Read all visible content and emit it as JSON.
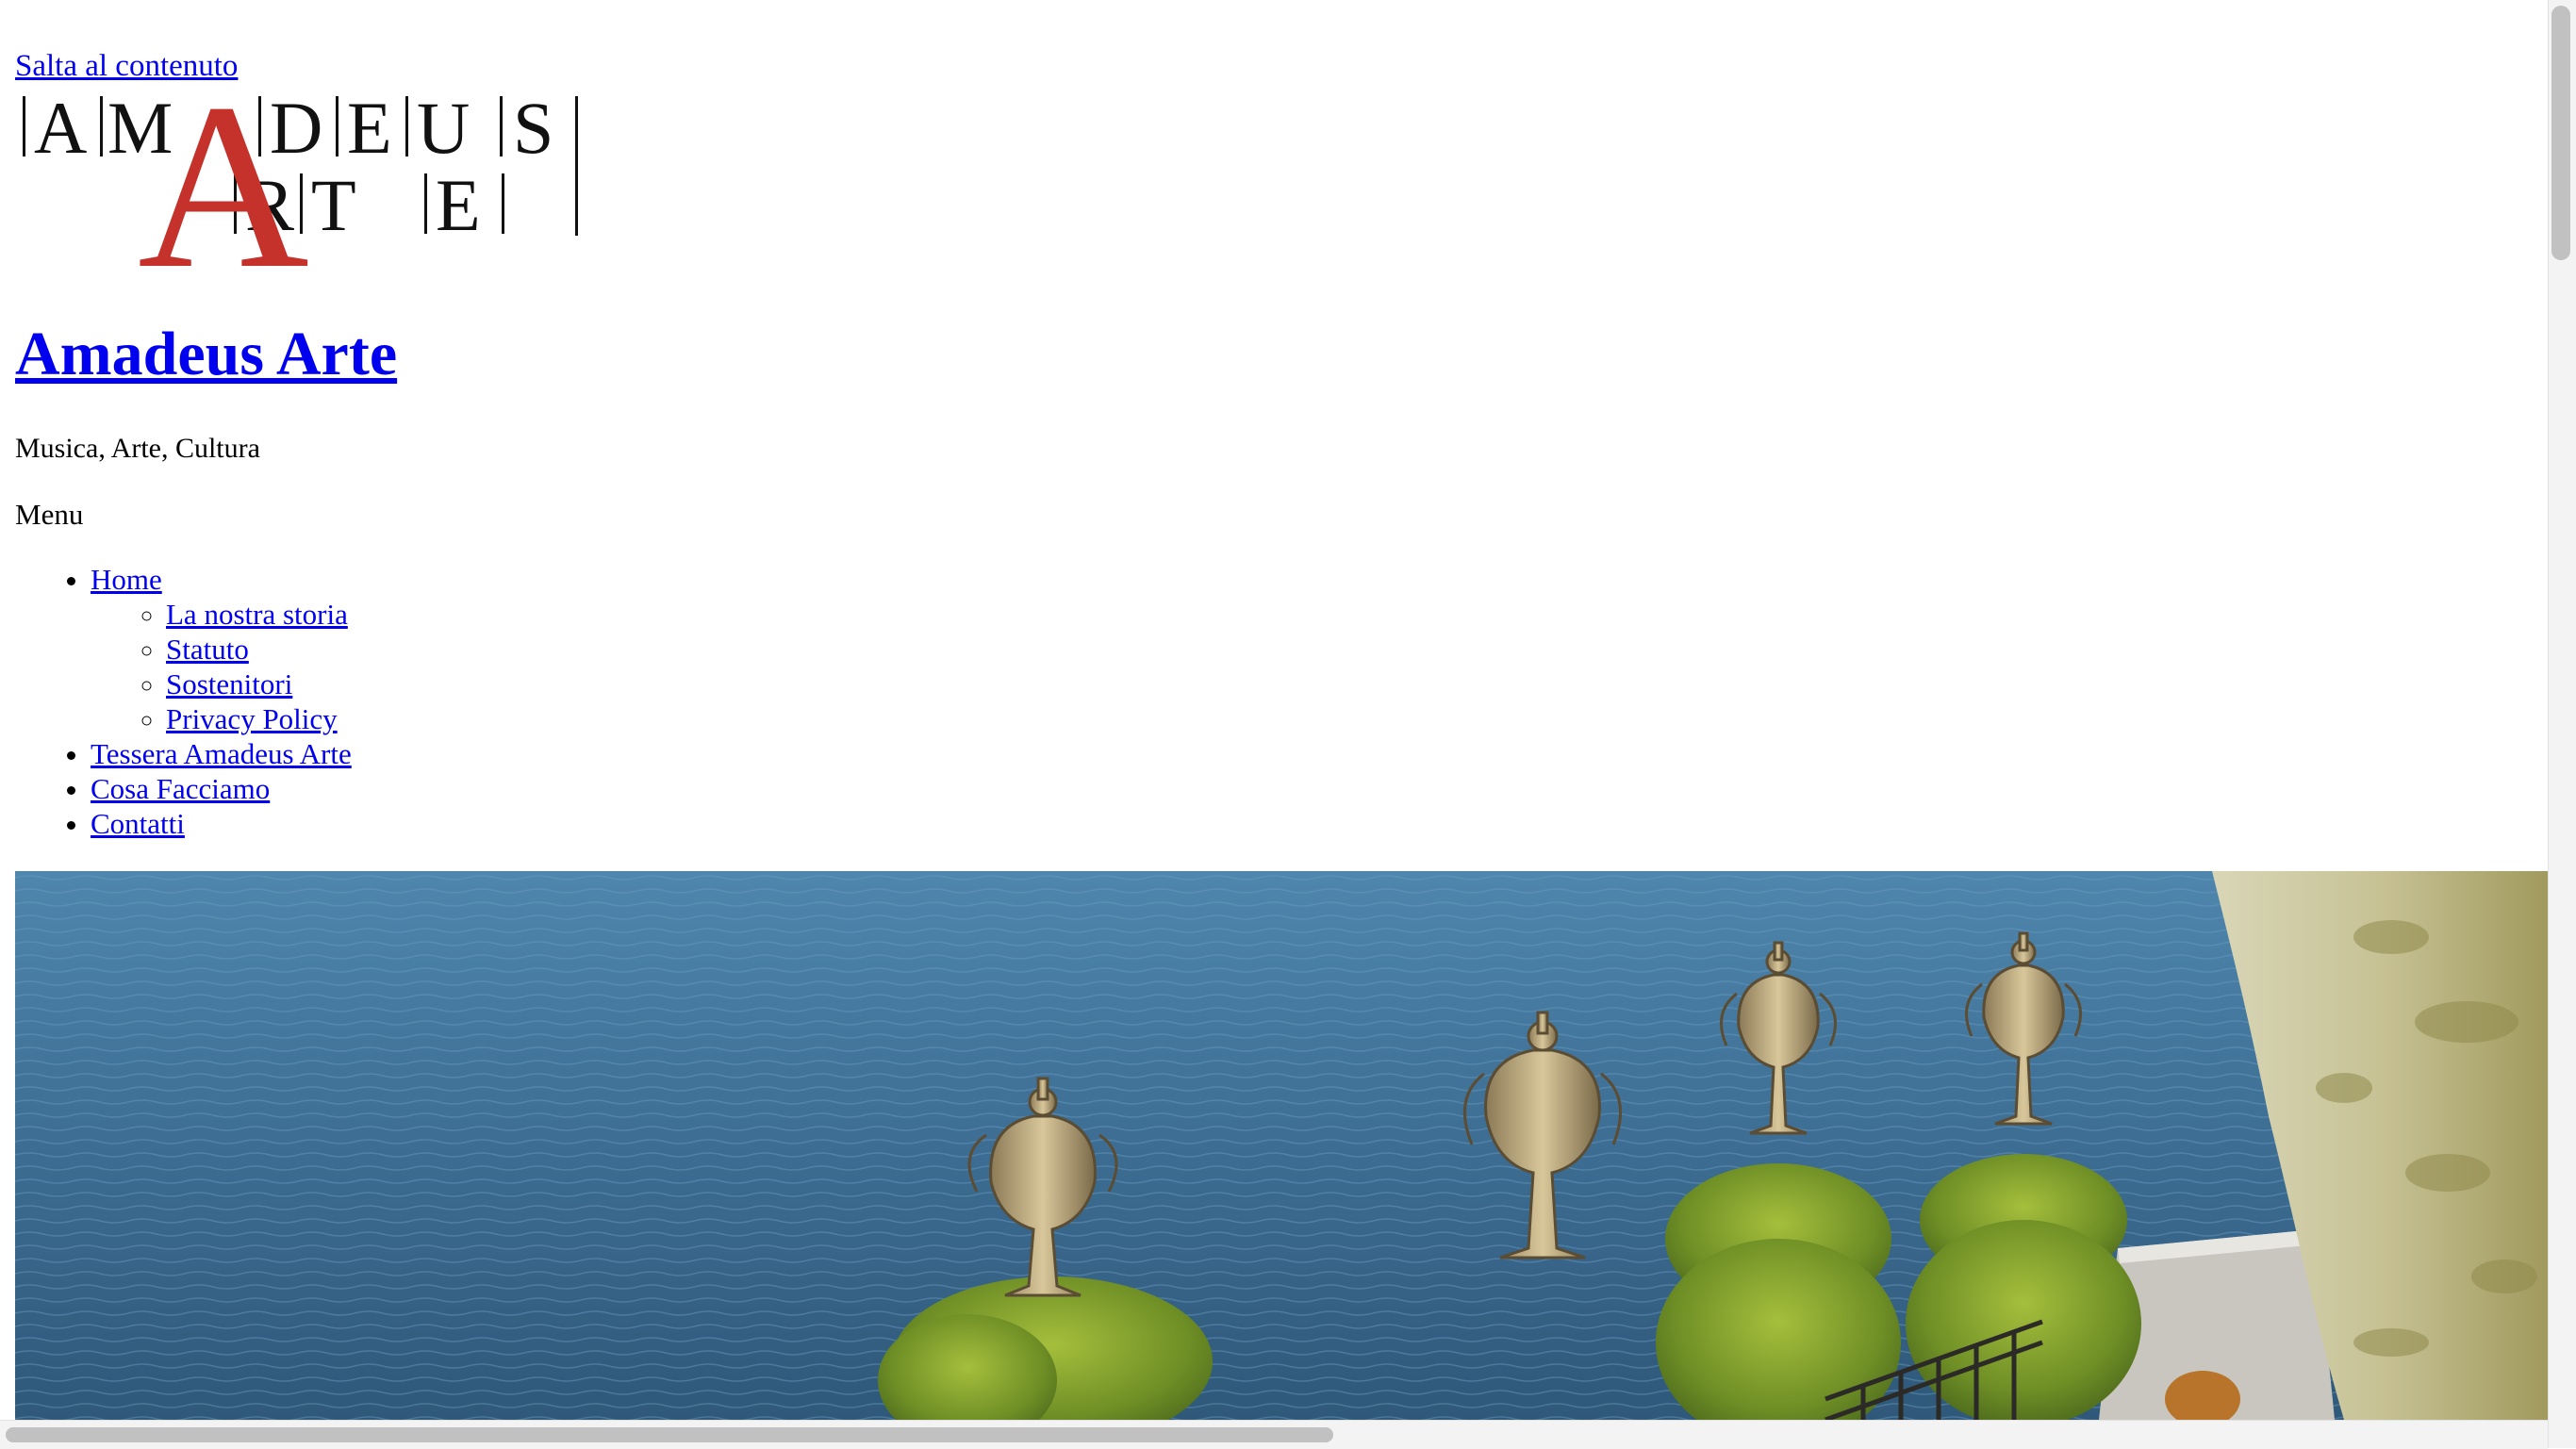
{
  "skip_link": "Salta al contenuto",
  "logo": {
    "top_letters": [
      "A",
      "M",
      "D",
      "E",
      "U",
      "S"
    ],
    "bottom_letters": [
      "R",
      "T",
      "E"
    ],
    "big_letter": "A",
    "accent": "#c4322b"
  },
  "site": {
    "title": "Amadeus Arte",
    "description": "Musica, Arte, Cultura"
  },
  "menu": {
    "label": "Menu",
    "items": [
      {
        "label": "Home",
        "children": [
          "La nostra storia",
          "Statuto",
          "Sostenitori",
          "Privacy Policy"
        ]
      },
      {
        "label": "Tessera Amadeus Arte"
      },
      {
        "label": "Cosa Facciamo"
      },
      {
        "label": "Contatti"
      }
    ]
  },
  "colors": {
    "link": "#0000ee",
    "lake": "#3f6f94"
  }
}
